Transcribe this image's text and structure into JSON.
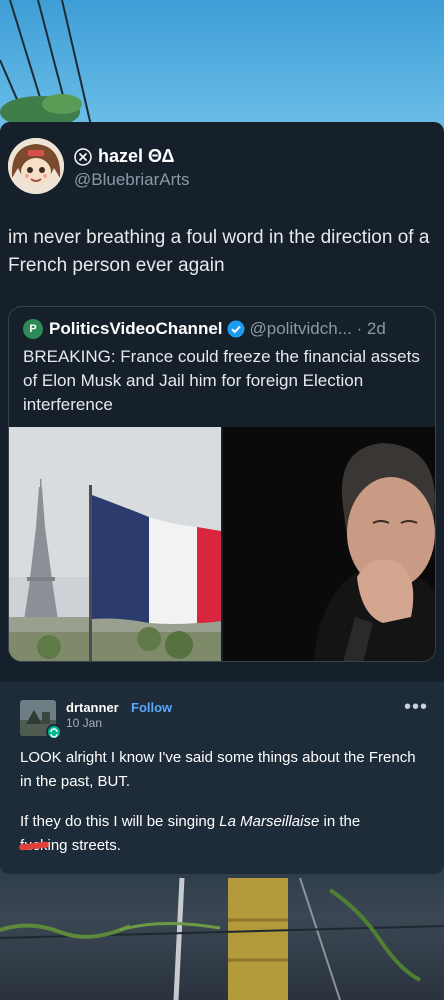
{
  "tweet": {
    "display_name": "hazel ΘΔ",
    "handle": "@BluebriarArts",
    "text": "im never breathing a foul word in the direction of a French person ever again",
    "quote": {
      "name": "PoliticsVideoChannel",
      "handle_time": "@politvidch... · 2d",
      "text": "BREAKING: France could freeze the financial assets of Elon Musk and Jail him for foreign Election interference"
    }
  },
  "post": {
    "username": "drtanner",
    "follow_label": "Follow",
    "date": "10 Jan",
    "more_label": "•••",
    "paragraph1": "LOOK alright I know I've said some things about the French in the past, BUT.",
    "p2_before": "If they do this I will be singing ",
    "p2_emphasis": "La Marseillaise",
    "p2_after": " in the",
    "p2_censored": "fucking",
    "p2_end": " streets."
  },
  "colors": {
    "card_bg": "#15202b",
    "post_bg": "#1e2b38",
    "follow_link": "#5aa8ff",
    "verified_badge": "#1d9bf0",
    "flag_blue": "#2b3b6e",
    "flag_red": "#d7263d"
  },
  "icons": {
    "x_logo": "x-logo-icon",
    "verified": "verified-badge-icon",
    "more": "more-options-icon",
    "reblog_badge": "reblog-badge-icon"
  }
}
